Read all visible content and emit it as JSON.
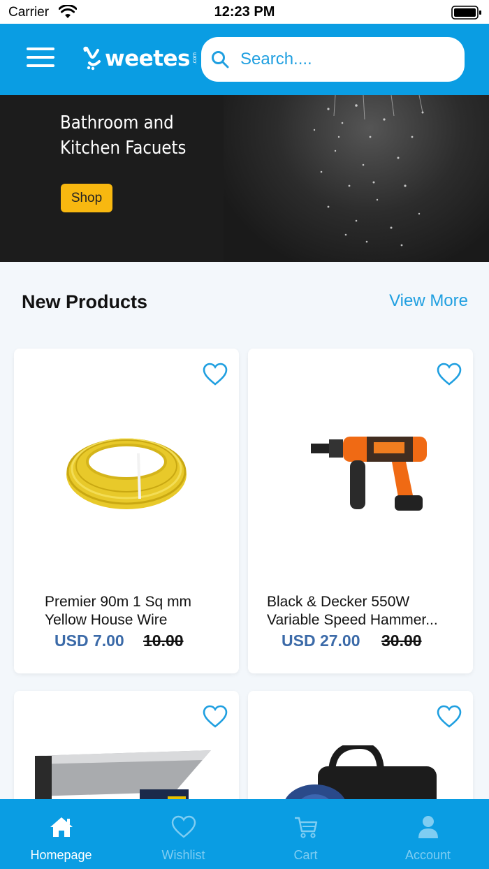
{
  "status_bar": {
    "carrier": "Carrier",
    "time": "12:23 PM"
  },
  "header": {
    "logo_text": "weetes",
    "logo_suffix": ".com",
    "search_placeholder": "Search...."
  },
  "banner": {
    "title_line1": "Bathroom and",
    "title_line2": "Kitchen Facuets",
    "shop_label": "Shop"
  },
  "section": {
    "title": "New Products",
    "view_more": "View More"
  },
  "products": [
    {
      "name_line1": "Premier 90m 1 Sq mm",
      "name_line2": "Yellow House Wire",
      "price": "USD 7.00",
      "old_price": "10.00",
      "image": "yellow-wire-coil"
    },
    {
      "name_line1": "Black & Decker 550W",
      "name_line2": "Variable Speed Hammer...",
      "price": "USD 27.00",
      "old_price": "30.00",
      "image": "orange-hammer-drill"
    },
    {
      "image": "steel-saw-table"
    },
    {
      "image": "blue-water-pump"
    }
  ],
  "tabs": [
    {
      "label": "Homepage",
      "icon": "home-icon",
      "active": true
    },
    {
      "label": "Wishlist",
      "icon": "heart-icon",
      "active": false
    },
    {
      "label": "Cart",
      "icon": "cart-icon",
      "active": false
    },
    {
      "label": "Account",
      "icon": "user-icon",
      "active": false
    }
  ],
  "colors": {
    "primary": "#0a9de3",
    "accent": "#f8b810",
    "price": "#3b6aa8",
    "link": "#1f9fe0"
  }
}
